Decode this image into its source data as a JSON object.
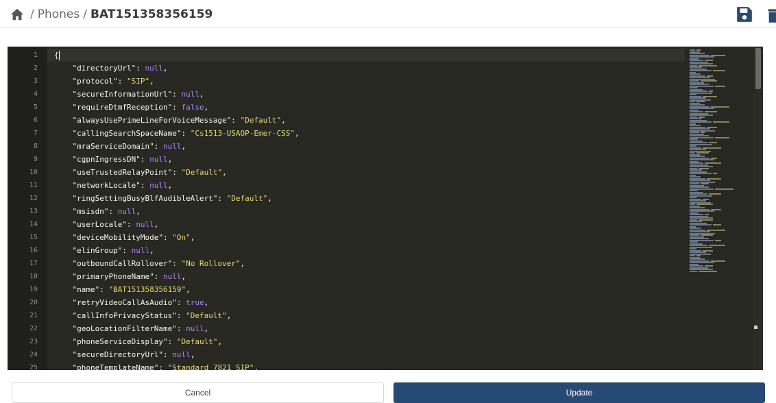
{
  "breadcrumb": {
    "home_icon": "home-icon",
    "separator": "/",
    "parent": "Phones",
    "current": "BAT151358356159"
  },
  "toolbar": {
    "save_icon": "save-icon",
    "delete_icon": "trash-icon"
  },
  "editor": {
    "theme": "dark",
    "line_numbers": [
      "1",
      "2",
      "3",
      "4",
      "5",
      "6",
      "7",
      "8",
      "9",
      "10",
      "11",
      "12",
      "13",
      "14",
      "15",
      "16",
      "17",
      "18",
      "19",
      "20",
      "21",
      "22",
      "23",
      "24",
      "25"
    ],
    "lines": [
      {
        "key": "directoryUrl",
        "value": "null",
        "value_type": "null"
      },
      {
        "key": "protocol",
        "value": "\"SIP\"",
        "value_type": "string"
      },
      {
        "key": "secureInformationUrl",
        "value": "null",
        "value_type": "null"
      },
      {
        "key": "requireDtmfReception",
        "value": "false",
        "value_type": "bool"
      },
      {
        "key": "alwaysUsePrimeLineForVoiceMessage",
        "value": "\"Default\"",
        "value_type": "string"
      },
      {
        "key": "callingSearchSpaceName",
        "value": "\"Cs1513-USAOP-Emer-CSS\"",
        "value_type": "string"
      },
      {
        "key": "mraServiceDomain",
        "value": "null",
        "value_type": "null"
      },
      {
        "key": "cgpnIngressDN",
        "value": "null",
        "value_type": "null"
      },
      {
        "key": "useTrustedRelayPoint",
        "value": "\"Default\"",
        "value_type": "string"
      },
      {
        "key": "networkLocale",
        "value": "null",
        "value_type": "null"
      },
      {
        "key": "ringSettingBusyBlfAudibleAlert",
        "value": "\"Default\"",
        "value_type": "string"
      },
      {
        "key": "msisdn",
        "value": "null",
        "value_type": "null"
      },
      {
        "key": "userLocale",
        "value": "null",
        "value_type": "null"
      },
      {
        "key": "deviceMobilityMode",
        "value": "\"On\"",
        "value_type": "string"
      },
      {
        "key": "elinGroup",
        "value": "null",
        "value_type": "null"
      },
      {
        "key": "outboundCallRollover",
        "value": "\"No Rollover\"",
        "value_type": "string"
      },
      {
        "key": "primaryPhoneName",
        "value": "null",
        "value_type": "null"
      },
      {
        "key": "name",
        "value": "\"BAT151358356159\"",
        "value_type": "string"
      },
      {
        "key": "retryVideoCallAsAudio",
        "value": "true",
        "value_type": "bool"
      },
      {
        "key": "callInfoPrivacyStatus",
        "value": "\"Default\"",
        "value_type": "string"
      },
      {
        "key": "geoLocationFilterName",
        "value": "null",
        "value_type": "null"
      },
      {
        "key": "phoneServiceDisplay",
        "value": "\"Default\"",
        "value_type": "string"
      },
      {
        "key": "secureDirectoryUrl",
        "value": "null",
        "value_type": "null"
      },
      {
        "key": "phoneTemplateName",
        "value": "\"Standard 7821 SIP\"",
        "value_type": "string"
      }
    ],
    "open_brace": "{"
  },
  "actions": {
    "cancel_label": "Cancel",
    "update_label": "Update"
  },
  "colors": {
    "update_button": "#264a73",
    "editor_bg": "#272822",
    "string": "#e6db74",
    "literal": "#ae81ff"
  }
}
